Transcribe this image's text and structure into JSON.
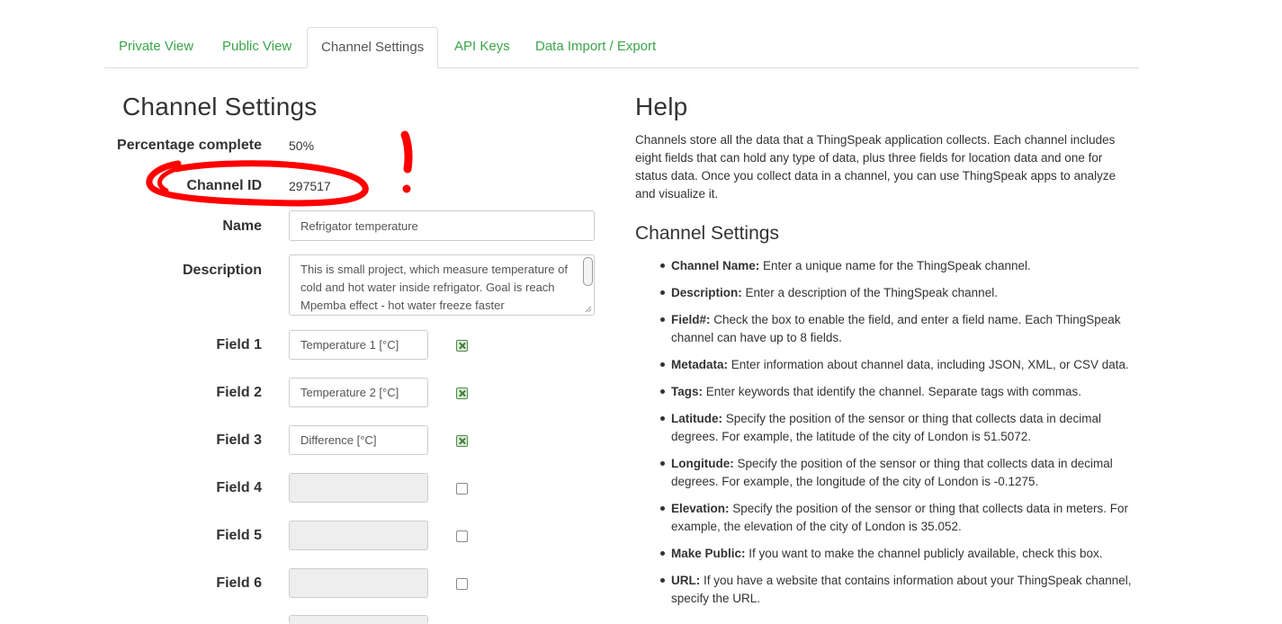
{
  "tabs": [
    {
      "label": "Private View"
    },
    {
      "label": "Public View"
    },
    {
      "label": "Channel Settings"
    },
    {
      "label": "API Keys"
    },
    {
      "label": "Data Import / Export"
    }
  ],
  "form": {
    "heading": "Channel Settings",
    "percentage_label": "Percentage complete",
    "percentage_value": "50%",
    "channel_id_label": "Channel ID",
    "channel_id_value": "297517",
    "name_label": "Name",
    "name_value": "Refrigator temperature",
    "description_label": "Description",
    "description_value": "This is small project, which measure temperature of cold and hot water inside refrigator. Goal is reach Mpemba effect - hot water freeze faster",
    "fields": [
      {
        "label": "Field 1",
        "value": "Temperature 1 [°C]",
        "checked": true
      },
      {
        "label": "Field 2",
        "value": "Temperature 2 [°C]",
        "checked": true
      },
      {
        "label": "Field 3",
        "value": "Difference [°C]",
        "checked": true
      },
      {
        "label": "Field 4",
        "value": "",
        "checked": false
      },
      {
        "label": "Field 5",
        "value": "",
        "checked": false
      },
      {
        "label": "Field 6",
        "value": "",
        "checked": false
      }
    ]
  },
  "help": {
    "heading": "Help",
    "intro": "Channels store all the data that a ThingSpeak application collects. Each channel includes eight fields that can hold any type of data, plus three fields for location data and one for status data. Once you collect data in a channel, you can use ThingSpeak apps to analyze and visualize it.",
    "subheading": "Channel Settings",
    "items": [
      {
        "term": "Channel Name:",
        "text": " Enter a unique name for the ThingSpeak channel."
      },
      {
        "term": "Description:",
        "text": " Enter a description of the ThingSpeak channel."
      },
      {
        "term": "Field#:",
        "text": " Check the box to enable the field, and enter a field name. Each ThingSpeak channel can have up to 8 fields."
      },
      {
        "term": "Metadata:",
        "text": " Enter information about channel data, including JSON, XML, or CSV data."
      },
      {
        "term": "Tags:",
        "text": " Enter keywords that identify the channel. Separate tags with commas."
      },
      {
        "term": "Latitude:",
        "text": " Specify the position of the sensor or thing that collects data in decimal degrees. For example, the latitude of the city of London is 51.5072."
      },
      {
        "term": "Longitude:",
        "text": " Specify the position of the sensor or thing that collects data in decimal degrees. For example, the longitude of the city of London is -0.1275."
      },
      {
        "term": "Elevation:",
        "text": " Specify the position of the sensor or thing that collects data in meters. For example, the elevation of the city of London is 35.052."
      },
      {
        "term": "Make Public:",
        "text": " If you want to make the channel publicly available, check this box."
      },
      {
        "term": "URL:",
        "text": " If you have a website that contains information about your ThingSpeak channel, specify the URL."
      }
    ]
  },
  "colors": {
    "tab_link": "#3aa648",
    "annotation": "#ff0000",
    "checkbox_checked": "#dcecd7"
  }
}
